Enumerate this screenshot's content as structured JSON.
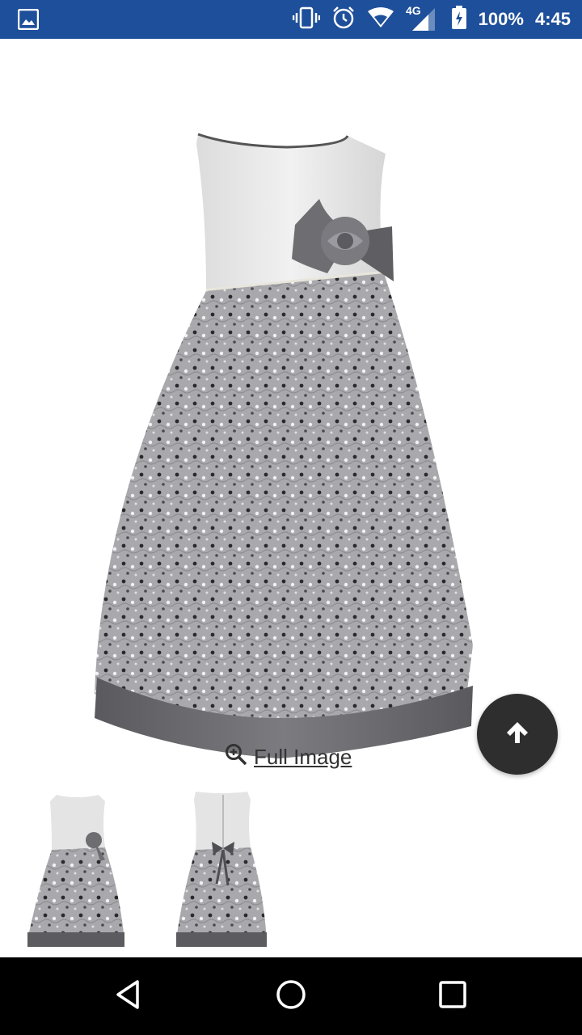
{
  "status_bar": {
    "battery_percent": "100%",
    "time": "4:45",
    "network": "4G LTE",
    "background_color": "#1e4f9a"
  },
  "product": {
    "full_image_label": "Full Image",
    "main_image_icon": "dress-image",
    "thumbnails": [
      "dress-front-thumbnail",
      "dress-back-thumbnail"
    ]
  },
  "fab": {
    "icon": "arrow-up-icon",
    "color": "#2e2e2e"
  },
  "nav_bar": {
    "back_icon": "back-triangle-icon",
    "home_icon": "home-circle-icon",
    "recents_icon": "recents-square-icon"
  }
}
